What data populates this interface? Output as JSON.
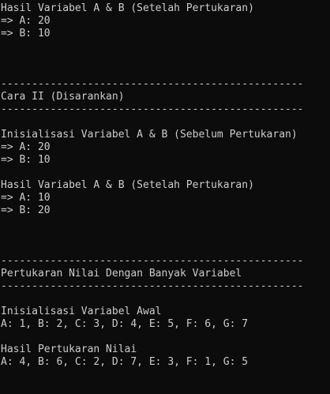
{
  "lines": [
    "Hasil Variabel A & B (Setelah Pertukaran)",
    "=> A: 20",
    "=> B: 10",
    "",
    "",
    "",
    "-------------------------------------------------",
    "Cara II (Disarankan)",
    "-------------------------------------------------",
    "",
    "Inisialisasi Variabel A & B (Sebelum Pertukaran)",
    "=> A: 20",
    "=> B: 10",
    "",
    "Hasil Variabel A & B (Setelah Pertukaran)",
    "=> A: 10",
    "=> B: 20",
    "",
    "",
    "",
    "-------------------------------------------------",
    "Pertukaran Nilai Dengan Banyak Variabel",
    "-------------------------------------------------",
    "",
    "Inisialisasi Variabel Awal",
    "A: 1, B: 2, C: 3, D: 4, E: 5, F: 6, G: 7",
    "",
    "Hasil Pertukaran Nilai",
    "A: 4, B: 6, C: 2, D: 7, E: 3, F: 1, G: 5"
  ]
}
